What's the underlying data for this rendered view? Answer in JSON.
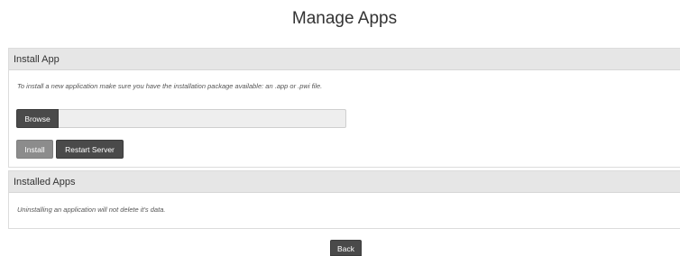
{
  "page": {
    "title": "Manage Apps"
  },
  "install_panel": {
    "header": "Install App",
    "description": "To install a new application make sure you have the installation package available: an .app or .pwi file.",
    "browse_label": "Browse",
    "file_value": "",
    "install_label": "Install",
    "restart_label": "Restart Server"
  },
  "installed_panel": {
    "header": "Installed Apps",
    "description": "Uninstalling an application will not delete it's data."
  },
  "footer": {
    "back_label": "Back"
  },
  "colors": {
    "button_dark": "#4a4a4a",
    "button_disabled": "#8c8c8c",
    "panel_header_bg": "#e6e6e6",
    "input_bg": "#eeeeee"
  }
}
